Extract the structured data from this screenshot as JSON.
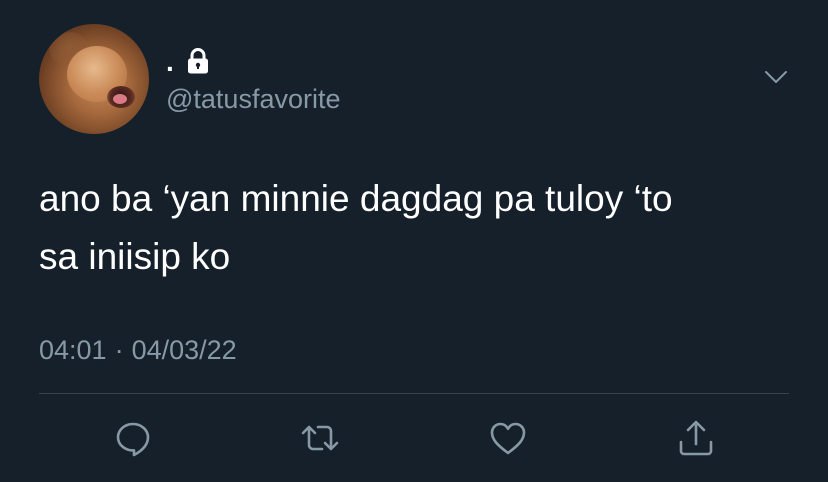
{
  "tweet": {
    "display_name": ".",
    "handle": "@tatusfavorite",
    "text_line1": "ano ba ‘yan minnie dagdag pa tuloy ‘to",
    "text_line2": "sa iniisip ko",
    "time": "04:01",
    "separator": "·",
    "date": "04/03/22"
  },
  "icons": {
    "lock": "lock-icon",
    "chevron": "chevron-down-icon",
    "reply": "reply-icon",
    "retweet": "retweet-icon",
    "like": "heart-icon",
    "share": "share-icon"
  },
  "colors": {
    "background": "#15202b",
    "text": "#ffffff",
    "secondary": "#8899a6",
    "divider": "#38444d"
  }
}
